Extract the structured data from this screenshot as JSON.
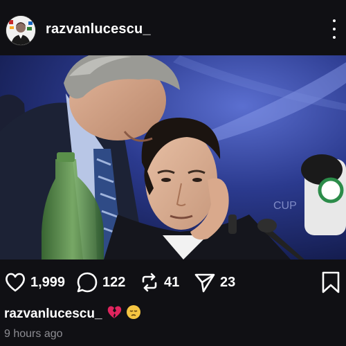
{
  "post": {
    "username": "razvanlucescu_",
    "timestamp": "9 hours ago"
  },
  "actions": {
    "likes": "1,999",
    "comments": "122",
    "reposts": "41",
    "shares": "23"
  },
  "caption": {
    "username": "razvanlucescu_",
    "emoji_1": "💔",
    "emoji_2": "😔"
  },
  "icons": {
    "more": "more-vertical-icon",
    "like": "heart-icon",
    "comment": "comment-bubble-icon",
    "repost": "repost-icon",
    "share": "send-icon",
    "bookmark": "bookmark-icon"
  },
  "colors": {
    "background": "#101014",
    "text": "#ffffff",
    "muted": "#8d8d93",
    "broken_heart": "#e0245e",
    "sad_face": "#f5c542"
  }
}
